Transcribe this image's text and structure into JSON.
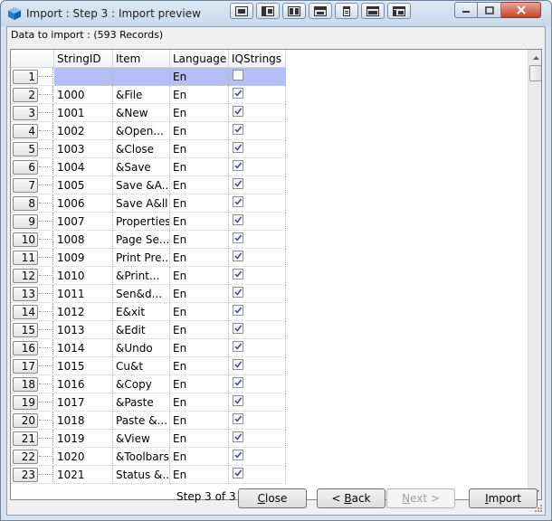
{
  "window": {
    "title": "Import : Step 3 : Import preview"
  },
  "records_label": "Data to import : (593 Records)",
  "columns": [
    "StringID",
    "Item",
    "Language",
    "IQStrings"
  ],
  "rows": [
    {
      "num": "1",
      "id": "",
      "item": "",
      "lang": "En",
      "checked": false,
      "selected": true
    },
    {
      "num": "2",
      "id": "1000",
      "item": "&File",
      "lang": "En",
      "checked": true
    },
    {
      "num": "3",
      "id": "1001",
      "item": "&New",
      "lang": "En",
      "checked": true
    },
    {
      "num": "4",
      "id": "1002",
      "item": "&Open...",
      "lang": "En",
      "checked": true
    },
    {
      "num": "5",
      "id": "1003",
      "item": "&Close",
      "lang": "En",
      "checked": true
    },
    {
      "num": "6",
      "id": "1004",
      "item": "&Save",
      "lang": "En",
      "checked": true
    },
    {
      "num": "7",
      "id": "1005",
      "item": "Save &A...",
      "lang": "En",
      "checked": true
    },
    {
      "num": "8",
      "id": "1006",
      "item": "Save A&ll",
      "lang": "En",
      "checked": true
    },
    {
      "num": "9",
      "id": "1007",
      "item": "Properties",
      "lang": "En",
      "checked": true
    },
    {
      "num": "10",
      "id": "1008",
      "item": "Page Se...",
      "lang": "En",
      "checked": true
    },
    {
      "num": "11",
      "id": "1009",
      "item": "Print Pre...",
      "lang": "En",
      "checked": true
    },
    {
      "num": "12",
      "id": "1010",
      "item": "&Print...",
      "lang": "En",
      "checked": true
    },
    {
      "num": "13",
      "id": "1011",
      "item": "Sen&d...",
      "lang": "En",
      "checked": true
    },
    {
      "num": "14",
      "id": "1012",
      "item": "E&xit",
      "lang": "En",
      "checked": true
    },
    {
      "num": "15",
      "id": "1013",
      "item": "&Edit",
      "lang": "En",
      "checked": true
    },
    {
      "num": "16",
      "id": "1014",
      "item": "&Undo",
      "lang": "En",
      "checked": true
    },
    {
      "num": "17",
      "id": "1015",
      "item": "Cu&t",
      "lang": "En",
      "checked": true
    },
    {
      "num": "18",
      "id": "1016",
      "item": "&Copy",
      "lang": "En",
      "checked": true
    },
    {
      "num": "19",
      "id": "1017",
      "item": "&Paste",
      "lang": "En",
      "checked": true
    },
    {
      "num": "20",
      "id": "1018",
      "item": "Paste &...",
      "lang": "En",
      "checked": true
    },
    {
      "num": "21",
      "id": "1019",
      "item": "&View",
      "lang": "En",
      "checked": true
    },
    {
      "num": "22",
      "id": "1020",
      "item": "&Toolbars",
      "lang": "En",
      "checked": true
    },
    {
      "num": "23",
      "id": "1021",
      "item": "Status &...",
      "lang": "En",
      "checked": true
    }
  ],
  "footer": {
    "step_text": "Step 3 of 3",
    "close_label": "Close",
    "close_label_rest": "lose",
    "back_prefix": "< ",
    "back_mnemonic": "B",
    "back_rest": "ack",
    "next_mnemonic": "N",
    "next_rest": "ext >",
    "import_mnemonic": "I",
    "import_rest": "mport"
  }
}
